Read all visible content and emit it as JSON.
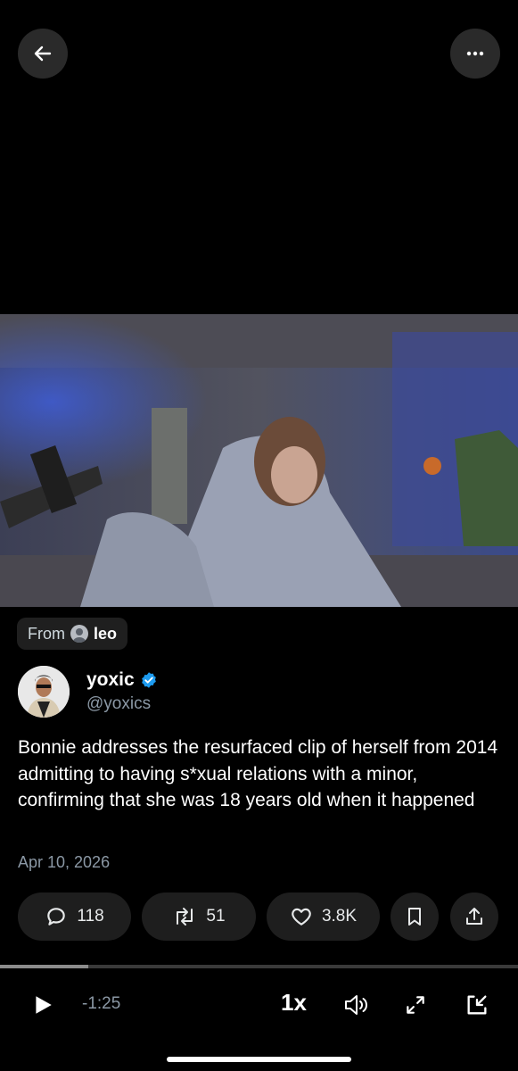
{
  "header": {
    "back_icon": "arrow-left-icon",
    "more_icon": "more-horizontal-icon"
  },
  "source": {
    "from_label": "From",
    "from_user": "leo"
  },
  "post": {
    "display_name": "yoxic",
    "verified": true,
    "handle": "@yoxics",
    "text": "Bonnie addresses the resurfaced clip of herself from 2014 admitting to having s*xual relations with a minor, confirming that she was 18 years old when it happened",
    "date": "Apr 10, 2026"
  },
  "actions": {
    "replies": "118",
    "reposts": "51",
    "likes": "3.8K"
  },
  "player": {
    "time_remaining": "-1:25",
    "speed": "1x",
    "progress": 0.17
  },
  "colors": {
    "background": "#000000",
    "verified_blue": "#1d9bf0",
    "muted_text": "#8b98a5",
    "pill_bg": "#1e1e1e"
  }
}
